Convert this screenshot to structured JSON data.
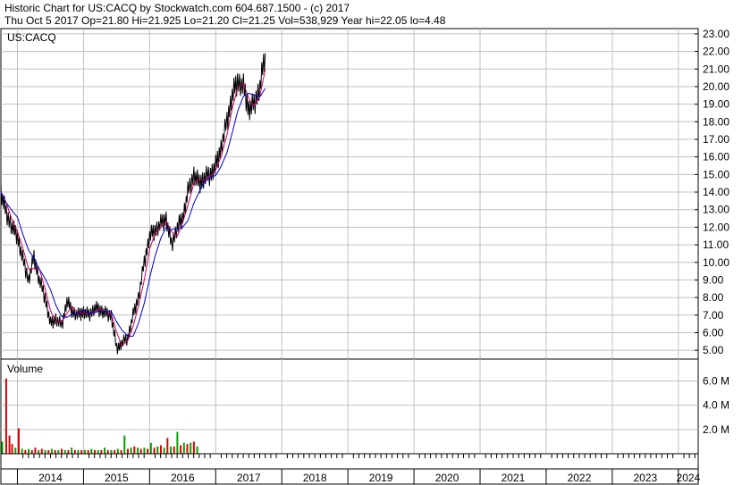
{
  "header": {
    "line1": "Historic Chart for US:CACQ by Stockwatch.com 604.687.1500 - (c) 2017",
    "line2": "Thu Oct  5 2017   Op=21.80   Hi=21.925   Lo=21.20   Cl=21.25   Vol=538,929   Year hi=22.05   lo=4.48"
  },
  "price_panel": {
    "label": "US:CACQ"
  },
  "volume_panel": {
    "label": "Volume"
  },
  "colors": {
    "price": "#000000",
    "ma_short": "#cc0066",
    "ma_long": "#0000cc",
    "volume_up": "#00a000",
    "volume_down": "#dd0000",
    "grid": "#c0c0c0"
  },
  "chart_data": [
    {
      "type": "line",
      "title": "US:CACQ",
      "ylim": [
        4.5,
        23.3
      ],
      "y_ticks": [
        "23.00",
        "22.00",
        "21.00",
        "20.00",
        "19.00",
        "18.00",
        "17.00",
        "16.00",
        "15.00",
        "14.00",
        "13.00",
        "12.00",
        "11.00",
        "10.00",
        "9.00",
        "8.00",
        "7.00",
        "6.00",
        "5.00"
      ],
      "x_ticks": [
        "2014",
        "2015",
        "2016",
        "2017",
        "2018",
        "2019",
        "2020",
        "2021",
        "2022",
        "2023",
        "2024"
      ],
      "series": [
        {
          "x": [
            2013.75,
            2013.83,
            2013.92,
            2014.0,
            2014.08,
            2014.17,
            2014.25,
            2014.33,
            2014.42,
            2014.5,
            2014.58,
            2014.67,
            2014.75,
            2014.83,
            2014.92,
            2015.0,
            2015.08,
            2015.17,
            2015.25,
            2015.33,
            2015.42,
            2015.5,
            2015.58,
            2015.67,
            2015.75,
            2015.83,
            2015.92,
            2016.0,
            2016.08,
            2016.17,
            2016.25,
            2016.33,
            2016.42,
            2016.5,
            2016.58,
            2016.67,
            2016.75,
            2016.83,
            2016.92,
            2017.0,
            2017.08,
            2017.17,
            2017.25,
            2017.33,
            2017.42,
            2017.5,
            2017.58,
            2017.67,
            2017.75
          ],
          "values": [
            14.0,
            12.8,
            12.0,
            11.5,
            10.2,
            9.0,
            10.3,
            9.0,
            8.0,
            6.5,
            6.8,
            6.4,
            7.8,
            7.2,
            7.0,
            7.2,
            7.0,
            7.4,
            7.3,
            7.1,
            7.0,
            5.1,
            5.4,
            5.7,
            7.0,
            8.0,
            10.0,
            11.5,
            11.8,
            12.2,
            12.5,
            11.0,
            12.0,
            12.5,
            14.0,
            15.0,
            14.5,
            14.8,
            15.0,
            15.5,
            16.5,
            18.0,
            19.5,
            20.3,
            20.0,
            18.7,
            19.0,
            20.0,
            21.9
          ]
        }
      ]
    },
    {
      "type": "bar",
      "title": "Volume",
      "ylim": [
        0,
        7.8
      ],
      "y_ticks": [
        "6.0 M",
        "4.0 M",
        "2.0 M"
      ],
      "x": [
        2013.77,
        2013.83,
        2013.88,
        2013.92,
        2013.97,
        2014.02,
        2014.07,
        2014.12,
        2014.17,
        2014.22,
        2014.27,
        2014.32,
        2014.37,
        2014.42,
        2014.47,
        2014.52,
        2014.57,
        2014.62,
        2014.67,
        2014.72,
        2014.77,
        2014.82,
        2014.87,
        2014.92,
        2014.97,
        2015.02,
        2015.07,
        2015.12,
        2015.17,
        2015.22,
        2015.27,
        2015.32,
        2015.37,
        2015.42,
        2015.47,
        2015.52,
        2015.57,
        2015.62,
        2015.67,
        2015.72,
        2015.77,
        2015.82,
        2015.87,
        2015.92,
        2015.97,
        2016.02,
        2016.07,
        2016.12,
        2016.17,
        2016.22,
        2016.27,
        2016.32,
        2016.37,
        2016.42,
        2016.47,
        2016.52,
        2016.57,
        2016.62,
        2016.67,
        2016.72
      ],
      "values": [
        1.0,
        6.2,
        1.5,
        0.8,
        0.5,
        2.1,
        0.4,
        0.3,
        0.4,
        0.3,
        0.5,
        0.3,
        0.4,
        0.3,
        0.3,
        0.4,
        0.3,
        0.3,
        0.4,
        0.3,
        0.3,
        0.5,
        0.3,
        0.3,
        0.3,
        0.3,
        0.3,
        0.4,
        0.3,
        0.3,
        0.3,
        0.5,
        0.3,
        0.3,
        0.3,
        0.4,
        0.3,
        1.5,
        0.4,
        0.5,
        0.6,
        0.5,
        0.4,
        0.5,
        0.4,
        0.9,
        0.5,
        0.6,
        0.7,
        0.5,
        1.3,
        0.6,
        0.6,
        1.8,
        0.7,
        0.9,
        0.8,
        0.9,
        1.0,
        0.6
      ],
      "up": [
        true,
        false,
        false,
        false,
        true,
        false,
        true,
        false,
        true,
        false,
        false,
        true,
        false,
        true,
        false,
        true,
        false,
        true,
        false,
        true,
        false,
        true,
        false,
        true,
        false,
        true,
        false,
        true,
        false,
        true,
        false,
        true,
        false,
        true,
        false,
        true,
        false,
        true,
        false,
        true,
        false,
        true,
        false,
        true,
        false,
        true,
        false,
        true,
        false,
        true,
        false,
        true,
        false,
        true,
        false,
        true,
        false,
        true,
        false,
        true
      ]
    }
  ]
}
